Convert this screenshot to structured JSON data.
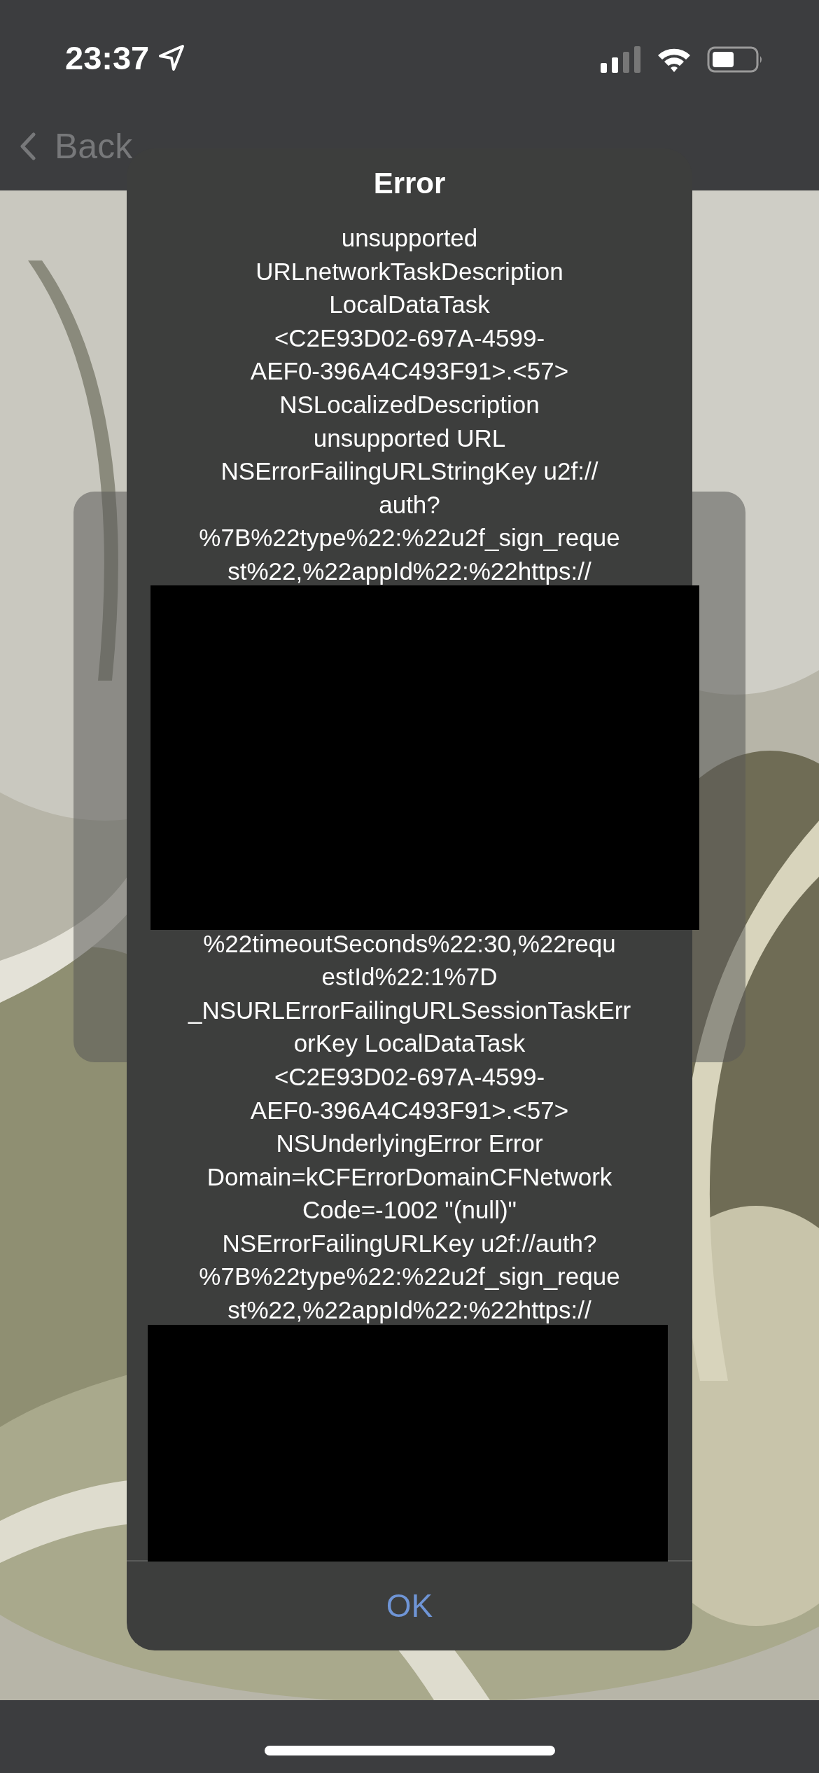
{
  "status_bar": {
    "time": "23:37"
  },
  "nav": {
    "back": "Back"
  },
  "alert": {
    "title": "Error",
    "parts": [
      {
        "kind": "text",
        "lines": [
          "unsupported",
          "URLnetworkTaskDescription",
          "LocalDataTask",
          "<C2E93D02-697A-4599-",
          "AEF0-396A4C493F91>.<57>",
          "NSLocalizedDescription",
          "unsupported URL",
          "NSErrorFailingURLStringKey u2f://",
          "auth?",
          "%7B%22type%22:%22u2f_sign_reque",
          "st%22,%22appId%22:%22https://"
        ]
      },
      {
        "kind": "redacted"
      },
      {
        "kind": "text",
        "lines": [
          "%22timeoutSeconds%22:30,%22requ",
          "estId%22:1%7D",
          "_NSURLErrorFailingURLSessionTaskErr",
          "orKey LocalDataTask",
          "<C2E93D02-697A-4599-",
          "AEF0-396A4C493F91>.<57>",
          "NSUnderlyingError Error",
          "Domain=kCFErrorDomainCFNetwork",
          "Code=-1002 \"(null)\"",
          "NSErrorFailingURLKey u2f://auth?",
          "%7B%22type%22:%22u2f_sign_reque",
          "st%22,%22appId%22:%22https://"
        ]
      },
      {
        "kind": "redacted"
      }
    ],
    "button": "OK"
  }
}
